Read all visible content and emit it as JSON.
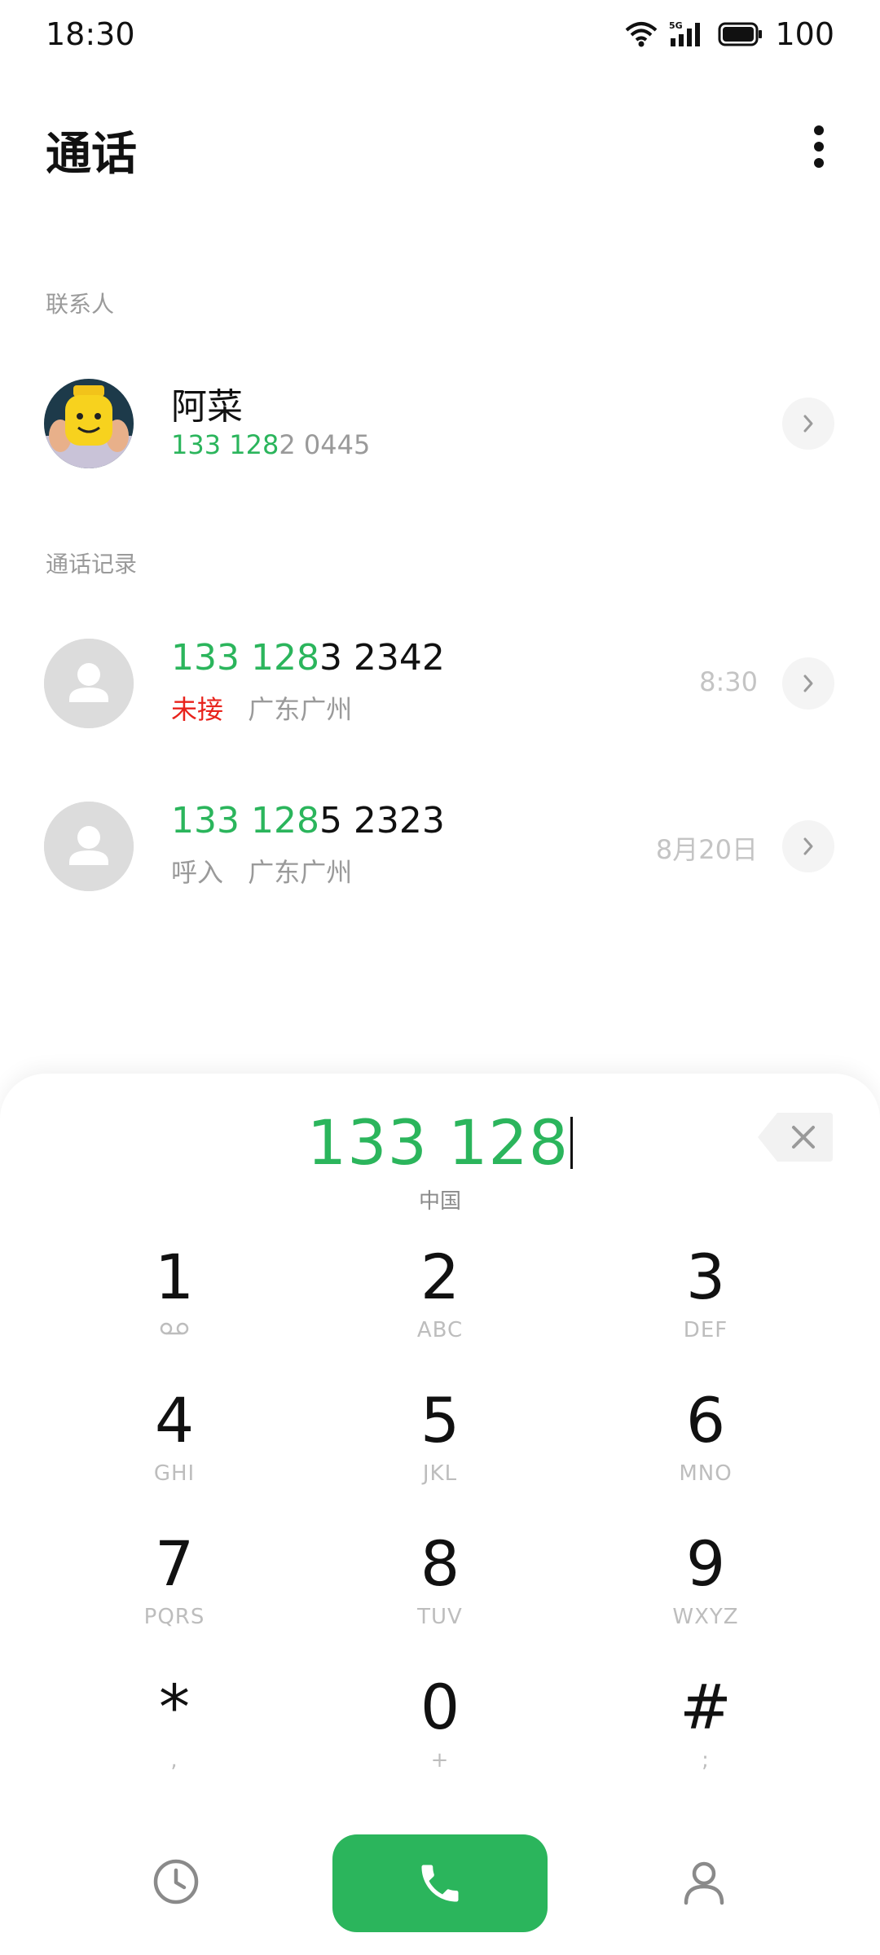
{
  "status_bar": {
    "time": "18:30",
    "battery": "100",
    "network": "5G"
  },
  "header": {
    "title": "通话",
    "more_icon": "more-vertical-icon"
  },
  "contacts_section": {
    "label": "联系人",
    "items": [
      {
        "name": "阿菜",
        "number_match": "133 128",
        "number_rest": "2 0445"
      }
    ]
  },
  "calls_section": {
    "label": "通话记录",
    "items": [
      {
        "number_match": "133 128",
        "number_rest": "3 2342",
        "type": "未接",
        "location": "广东广州",
        "time": "8:30"
      },
      {
        "number_match": "133 128",
        "number_rest": "5 2323",
        "type": "呼入",
        "location": "广东广州",
        "time": "8月20日"
      }
    ]
  },
  "dialer": {
    "input": "133 128",
    "region": "中国",
    "keys": [
      {
        "digit": "1",
        "sub": ""
      },
      {
        "digit": "2",
        "sub": "ABC"
      },
      {
        "digit": "3",
        "sub": "DEF"
      },
      {
        "digit": "4",
        "sub": "GHI"
      },
      {
        "digit": "5",
        "sub": "JKL"
      },
      {
        "digit": "6",
        "sub": "MNO"
      },
      {
        "digit": "7",
        "sub": "PQRS"
      },
      {
        "digit": "8",
        "sub": "TUV"
      },
      {
        "digit": "9",
        "sub": "WXYZ"
      },
      {
        "digit": "*",
        "sub": ","
      },
      {
        "digit": "0",
        "sub": "+"
      },
      {
        "digit": "#",
        "sub": ";"
      }
    ]
  },
  "colors": {
    "accent": "#2bb55c",
    "missed": "#e8231c",
    "muted": "#9a9a9a"
  }
}
